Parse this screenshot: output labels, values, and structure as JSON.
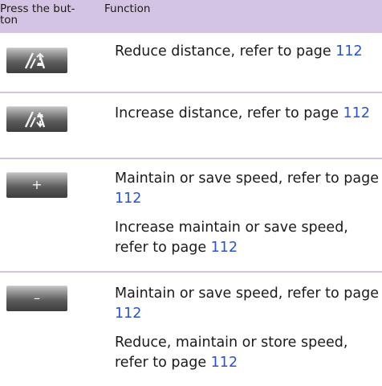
{
  "header": {
    "col_press": "Press the but-\nton",
    "col_function": "Function"
  },
  "rows": [
    {
      "button_icon": "reduce-distance-icon",
      "entries": [
        {
          "text": "Reduce distance, refer to page ",
          "page": "112"
        }
      ]
    },
    {
      "button_icon": "increase-distance-icon",
      "entries": [
        {
          "text": "Increase distance, refer to page ",
          "page": "112"
        }
      ]
    },
    {
      "button_icon": "plus-icon",
      "button_glyph": "+",
      "entries": [
        {
          "text": "Maintain or save speed, refer to page ",
          "page": "112"
        },
        {
          "text": "Increase maintain or save speed, refer to page ",
          "page": "112"
        }
      ]
    },
    {
      "button_icon": "minus-icon",
      "button_glyph": "–",
      "entries": [
        {
          "text": "Maintain or save speed, refer to page ",
          "page": "112"
        },
        {
          "text": "Reduce, maintain or store speed, refer to page ",
          "page": "112"
        }
      ]
    }
  ],
  "colors": {
    "header_bg": "#d4c4e3",
    "link": "#2a55c8"
  }
}
